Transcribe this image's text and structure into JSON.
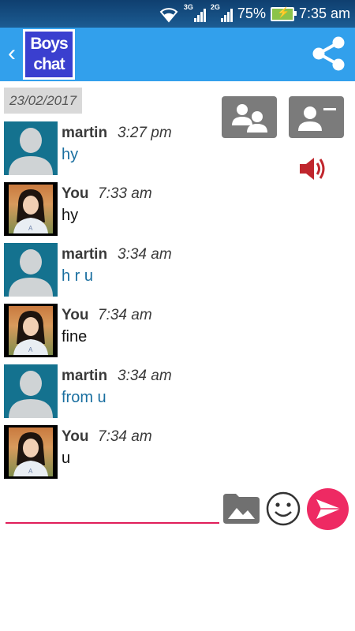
{
  "status_bar": {
    "battery": "75%",
    "time": "7:35 am",
    "net1": "3G",
    "net2": "2G"
  },
  "app_bar": {
    "logo_line1": "Boys",
    "logo_line2": "chat"
  },
  "date": "23/02/2017",
  "messages": [
    {
      "sender": "martin",
      "time": "3:27 pm",
      "text": "hy",
      "avatar": "default"
    },
    {
      "sender": "You",
      "time": "7:33 am",
      "text": "hy",
      "avatar": "photo"
    },
    {
      "sender": "martin",
      "time": "3:34 am",
      "text": "h r u",
      "avatar": "default"
    },
    {
      "sender": "You",
      "time": "7:34 am",
      "text": "fine",
      "avatar": "photo"
    },
    {
      "sender": "martin",
      "time": "3:34 am",
      "text": "from u",
      "avatar": "default"
    },
    {
      "sender": "You",
      "time": "7:34 am",
      "text": "u",
      "avatar": "photo"
    }
  ],
  "compose": {
    "value": "",
    "placeholder": ""
  },
  "colors": {
    "app_bar": "#32a0ec",
    "accent": "#e01e5a",
    "incoming_text": "#1a6fa0",
    "speaker": "#c0262d"
  },
  "icons": [
    "back-icon",
    "share-icon",
    "group-icon",
    "remove-contact-icon",
    "speaker-icon",
    "image-icon",
    "emoji-icon",
    "send-icon"
  ]
}
